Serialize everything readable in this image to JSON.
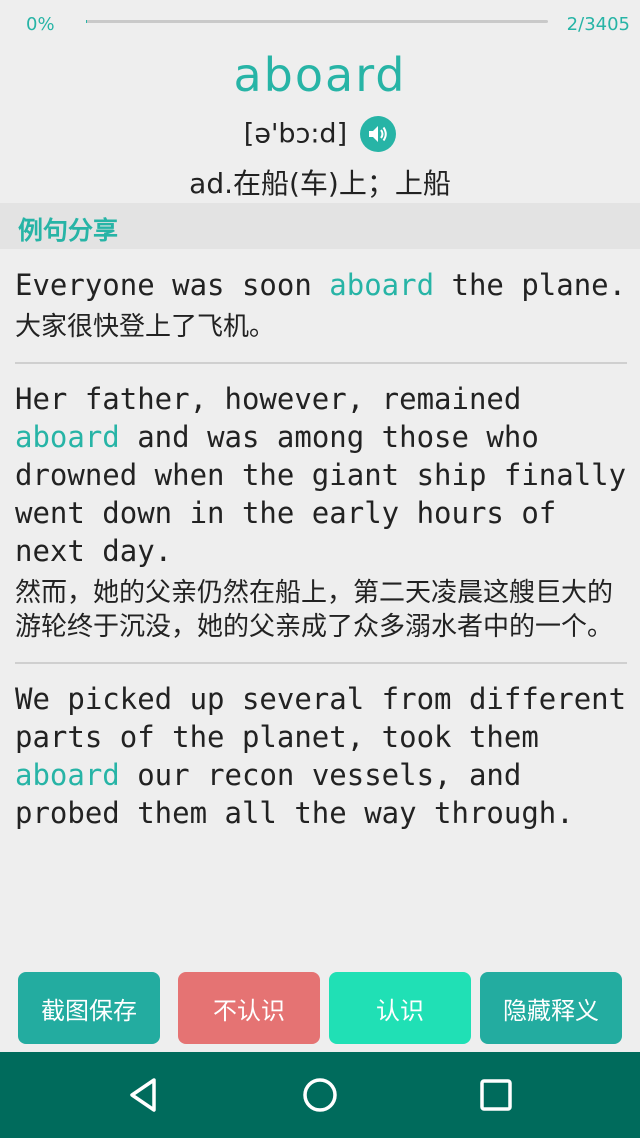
{
  "progress": {
    "percent_label": "0%",
    "count_label": "2/3405",
    "fraction": 0.0006
  },
  "word": "aboard",
  "phonetic": "[ə'bɔ:d]",
  "definition": "ad.在船(车)上；上船",
  "section_title": "例句分享",
  "examples": [
    {
      "en_before": "Everyone was soon ",
      "highlight": "aboard",
      "en_after": " the plane.",
      "zh": "大家很快登上了飞机。"
    },
    {
      "en_before": "Her father, however, remained ",
      "highlight": "aboard",
      "en_after": " and was among those who drowned when the giant ship finally went down in the early hours of next day.",
      "zh": "然而，她的父亲仍然在船上，第二天凌晨这艘巨大的游轮终于沉没，她的父亲成了众多溺水者中的一个。"
    },
    {
      "en_before": "We picked up several from different parts of the planet, took them ",
      "highlight": "aboard",
      "en_after": " our recon vessels, and probed them all the way through.",
      "zh": ""
    }
  ],
  "buttons": {
    "screenshot_save": "截图保存",
    "dont_know": "不认识",
    "know": "认识",
    "hide_meaning": "隐藏释义"
  },
  "icons": {
    "speaker": "speaker-icon",
    "back": "back-triangle-icon",
    "home": "home-circle-icon",
    "recent": "recent-square-icon"
  },
  "colors": {
    "accent": "#27b4a6",
    "danger": "#e57373",
    "know": "#20e0b5",
    "navbar": "#006b5c"
  }
}
